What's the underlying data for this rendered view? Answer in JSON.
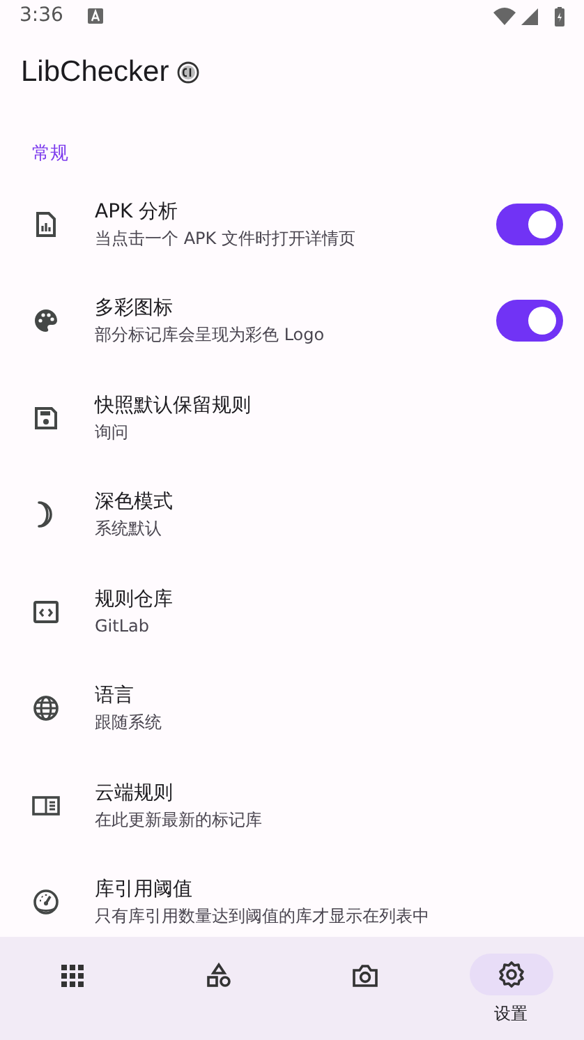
{
  "status_bar": {
    "time": "3:36"
  },
  "app_bar": {
    "title": "LibChecker"
  },
  "section": {
    "title": "常规"
  },
  "settings": [
    {
      "kind": "switch",
      "title": "APK 分析",
      "summary": "当点击一个 APK 文件时打开详情页",
      "on": true
    },
    {
      "kind": "switch",
      "title": "多彩图标",
      "summary": "部分标记库会呈现为彩色 Logo",
      "on": true
    },
    {
      "kind": "plain",
      "title": "快照默认保留规则",
      "summary": "询问"
    },
    {
      "kind": "plain",
      "title": "深色模式",
      "summary": "系统默认"
    },
    {
      "kind": "plain",
      "title": "规则仓库",
      "summary": "GitLab"
    },
    {
      "kind": "plain",
      "title": "语言",
      "summary": "跟随系统"
    },
    {
      "kind": "plain",
      "title": "云端规则",
      "summary": "在此更新最新的标记库"
    },
    {
      "kind": "plain",
      "title": "库引用阈值",
      "summary": "只有库引用数量达到阈值的库才显示在列表中"
    }
  ],
  "bottom_nav": [
    {
      "selected": false
    },
    {
      "selected": false
    },
    {
      "selected": false
    },
    {
      "label": "设置",
      "selected": true
    }
  ]
}
